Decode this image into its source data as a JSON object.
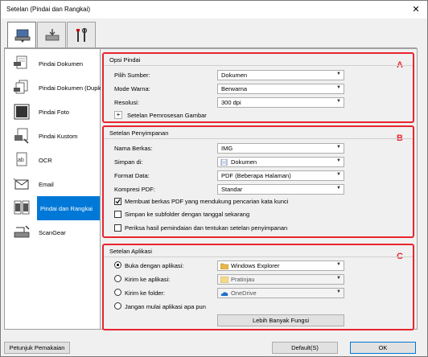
{
  "window": {
    "title": "Setelan (Pindai dan Rangkai)",
    "close_glyph": "✕"
  },
  "tabs": [
    {
      "name": "scan-tab",
      "icon": "scanner-icon"
    },
    {
      "name": "scan-to-pc-tab",
      "icon": "scan-to-pc-icon"
    },
    {
      "name": "general-settings-tab",
      "icon": "tools-icon"
    }
  ],
  "sidebar": {
    "items": [
      {
        "label": "Pindai Dokumen",
        "icon": "document-pdf-icon"
      },
      {
        "label": "Pindai Dokumen (Dupleks)",
        "icon": "duplex-document-icon"
      },
      {
        "label": "Pindai Foto",
        "icon": "photo-icon"
      },
      {
        "label": "Pindai Kustom",
        "icon": "custom-scan-icon"
      },
      {
        "label": "OCR",
        "icon": "ocr-icon"
      },
      {
        "label": "Email",
        "icon": "email-icon"
      },
      {
        "label": "Pindai dan Rangkai",
        "icon": "stitch-icon",
        "selected": true
      },
      {
        "label": "ScanGear",
        "icon": "scangear-icon"
      }
    ]
  },
  "scan_options": {
    "title": "Opsi Pindai",
    "letter": "A",
    "source_label": "Pilih Sumber:",
    "source_value": "Dokumen",
    "color_mode_label": "Mode Warna:",
    "color_mode_value": "Berwarna",
    "resolution_label": "Resolusi:",
    "resolution_value": "300 dpi",
    "image_processing_label": "Setelan Pemrosesan Gambar",
    "expand_glyph": "+"
  },
  "save_settings": {
    "title": "Setelan Penyimpanan",
    "letter": "B",
    "filename_label": "Nama Berkas:",
    "filename_value": "IMG",
    "save_in_label": "Simpan di:",
    "save_in_value": "Dokumen",
    "data_format_label": "Format Data:",
    "data_format_value": "PDF (Beberapa Halaman)",
    "pdf_compression_label": "Kompresi PDF:",
    "pdf_compression_value": "Standar",
    "check_keyword_search": "Membuat berkas PDF yang mendukung pencarian kata kunci",
    "check_keyword_search_checked": true,
    "check_subfolder": "Simpan ke subfolder dengan tanggal sekarang",
    "check_subfolder_checked": false,
    "check_review": "Periksa hasil pemindaian dan tentukan setelan penyimpanan",
    "check_review_checked": false
  },
  "app_settings": {
    "title": "Setelan Aplikasi",
    "letter": "C",
    "open_with_label": "Buka dengan aplikasi:",
    "open_with_value": "Windows Explorer",
    "send_to_app_label": "Kirim ke aplikasi:",
    "send_to_app_value": "Pratinjau",
    "send_to_folder_label": "Kirim ke folder:",
    "send_to_folder_value": "OneDrive",
    "no_app_label": "Jangan mulai aplikasi apa pun",
    "more_functions_label": "Lebih Banyak Fungsi",
    "selected_option": "open_with"
  },
  "footer": {
    "instructions_label": "Petunjuk Pemakaian",
    "defaults_label": "Default(S)",
    "ok_label": "OK"
  },
  "colors": {
    "accent": "#0078d7",
    "highlight_border": "#e8242e"
  },
  "dropdown_arrow": "▼"
}
